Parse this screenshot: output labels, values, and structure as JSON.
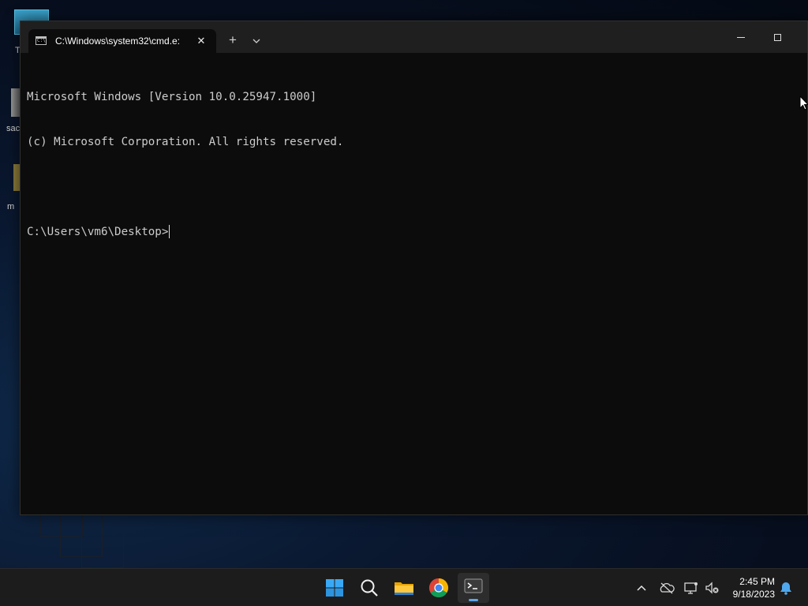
{
  "desktop": {
    "labels": [
      "T",
      "sac",
      "m"
    ]
  },
  "window": {
    "tab_title": "C:\\Windows\\system32\\cmd.e:",
    "tab_icon_text": "C:\\",
    "new_tab_symbol": "+",
    "close_symbol": "✕"
  },
  "console": {
    "line1": "Microsoft Windows [Version 10.0.25947.1000]",
    "line2": "(c) Microsoft Corporation. All rights reserved.",
    "line3": "",
    "prompt": "C:\\Users\\vm6\\Desktop>"
  },
  "taskbar": {
    "icons": [
      "windows-start-icon",
      "search-icon",
      "file-explorer-icon",
      "chrome-icon",
      "terminal-icon"
    ],
    "tray_icons": [
      "chevron-up-icon",
      "onedrive-offline-icon",
      "network-icon",
      "volume-muted-icon",
      "notification-bell-icon"
    ],
    "time": "2:45 PM",
    "date": "9/18/2023"
  },
  "colors": {
    "console_bg": "#0c0c0c",
    "console_text": "#cccccc",
    "titlebar_bg": "#1f1f1f",
    "taskbar_bg": "#1c1c1c",
    "accent": "#5ea7ea"
  }
}
